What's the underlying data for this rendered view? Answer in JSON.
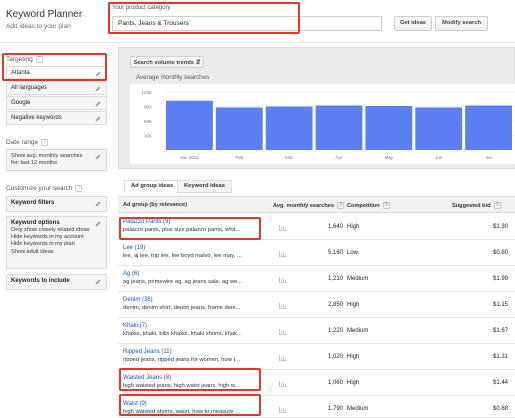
{
  "header": {
    "title": "Keyword Planner",
    "subtitle": "Add ideas to your plan",
    "category_label": "Your product category",
    "category_value": "Pants, Jeans & Trousers",
    "get_ideas": "Get ideas",
    "modify_search": "Modify search"
  },
  "sidebar": {
    "targeting_label": "Targeting",
    "targeting_items": [
      "Atlanta",
      "All languages",
      "Google",
      "Negative keywords"
    ],
    "date_range_label": "Date range",
    "date_range_value": "Show avg. monthly searches for: last 12 months",
    "customize_label": "Customize your search",
    "keyword_filters": "Keyword filters",
    "keyword_options_title": "Keyword options",
    "keyword_options_lines": [
      "Only show closely related ideas",
      "Hide keywords in my account",
      "Hide keywords in my plan",
      "Show adult ideas"
    ],
    "keywords_to_include": "Keywords to include"
  },
  "chart": {
    "toggle_label": "Search volume trends",
    "title": "Average monthly searches",
    "bar_color": "#5b7ff0"
  },
  "chart_data": {
    "type": "bar",
    "title": "Average monthly searches",
    "categories": [
      "Jan 2015",
      "Feb",
      "Mar",
      "Apr",
      "May",
      "Jun",
      "Jul"
    ],
    "tick_labels": [
      "Jan 2015",
      "Feb",
      "Mar",
      "Apr",
      "May",
      "Jun",
      "Jul"
    ],
    "values": [
      102000,
      88000,
      90000,
      92000,
      91000,
      88000,
      92000
    ],
    "yticks": [
      "120K",
      "90K",
      "60K",
      "30K"
    ],
    "ylim": [
      0,
      120000
    ],
    "grid": true
  },
  "tabs": [
    {
      "label": "Ad group ideas",
      "active": true
    },
    {
      "label": "Keyword ideas",
      "active": false
    }
  ],
  "table": {
    "headers": {
      "group": "Ad group (by relevance)",
      "volume": "Avg. monthly searches",
      "competition": "Competition",
      "bid": "Suggested bid"
    },
    "rows": [
      {
        "name": "Palazzo Pants (9)",
        "keywords": "palazzo pants, plus size palazzo pants, whit...",
        "volume": "1,640",
        "competition": "High",
        "bid": "$1.30"
      },
      {
        "name": "Lee (19)",
        "keywords": "lee, aj lee, trip lee, lee boyd malvo, lee may, ...",
        "volume": "5,160",
        "competition": "Low",
        "bid": "$0.80"
      },
      {
        "name": "Ag (6)",
        "keywords": "ag jeans, primewire ag, ag jeans sale, ag we...",
        "volume": "1,210",
        "competition": "Medium",
        "bid": "$1.99"
      },
      {
        "name": "Denim (36)",
        "keywords": "denim, denim shirt, denim jeans, frame deni...",
        "volume": "2,850",
        "competition": "High",
        "bid": "$1.15"
      },
      {
        "name": "Khaki (7)",
        "keywords": "khakis, khaki, bills khakis, khaki shorts, khak...",
        "volume": "1,220",
        "competition": "Medium",
        "bid": "$1.67"
      },
      {
        "name": "Ripped Jeans (11)",
        "keywords": "ripped jeans, ripped jeans for women, how t...",
        "volume": "1,020",
        "competition": "High",
        "bid": "$1.31"
      },
      {
        "name": "Waisted Jeans (8)",
        "keywords": "high waisted jeans, high waist jeans, high w...",
        "volume": "1,060",
        "competition": "High",
        "bid": "$1.44"
      },
      {
        "name": "Waist (9)",
        "keywords": "high waisted shorts, waist, how to measure ...",
        "volume": "1,790",
        "competition": "Medium",
        "bid": "$0.88"
      }
    ]
  },
  "highlight_color": "#e0392b"
}
